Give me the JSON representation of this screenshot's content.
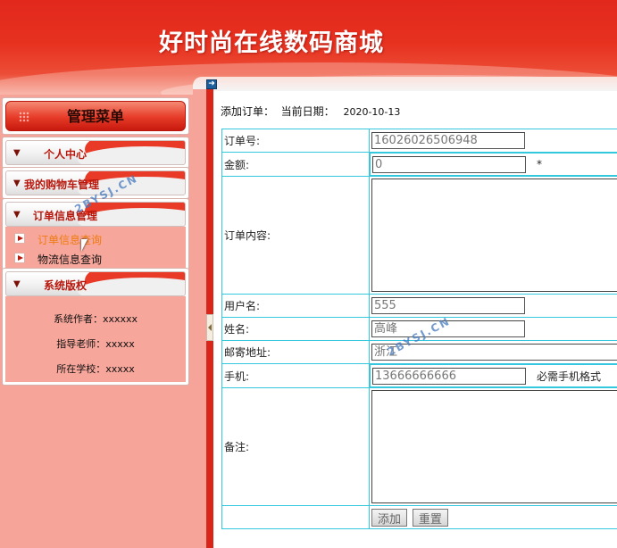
{
  "header": {
    "title": "好时尚在线数码商城"
  },
  "sidebar": {
    "menu_title": "管理菜单",
    "groups": [
      {
        "label": "个人中心"
      },
      {
        "label": "我的购物车管理"
      },
      {
        "label": "订单信息管理",
        "items": [
          {
            "label": "订单信息查询"
          },
          {
            "label": "物流信息查询"
          }
        ]
      },
      {
        "label": "系统版权",
        "lines": [
          "系统作者：xxxxxx",
          "指导老师：xxxxx",
          "所在学校：xxxxx"
        ]
      }
    ]
  },
  "main": {
    "heading": "添加订单：  当前日期：",
    "date": "2020-10-13",
    "form": {
      "order_no": {
        "label": "订单号:",
        "value": "16026026506948"
      },
      "amount": {
        "label": "金额:",
        "value": "0",
        "required": "*"
      },
      "content": {
        "label": "订单内容:"
      },
      "username": {
        "label": "用户名:",
        "value": "555"
      },
      "name": {
        "label": "姓名:",
        "value": "高峰"
      },
      "address": {
        "label": "邮寄地址:",
        "value": "浙江"
      },
      "phone": {
        "label": "手机:",
        "value": "13666666666",
        "hint": "必需手机格式"
      },
      "remark": {
        "label": "备注:"
      },
      "add_button": "添加",
      "reset_button": "重置"
    }
  },
  "watermark": "2BYSJ.CN"
}
